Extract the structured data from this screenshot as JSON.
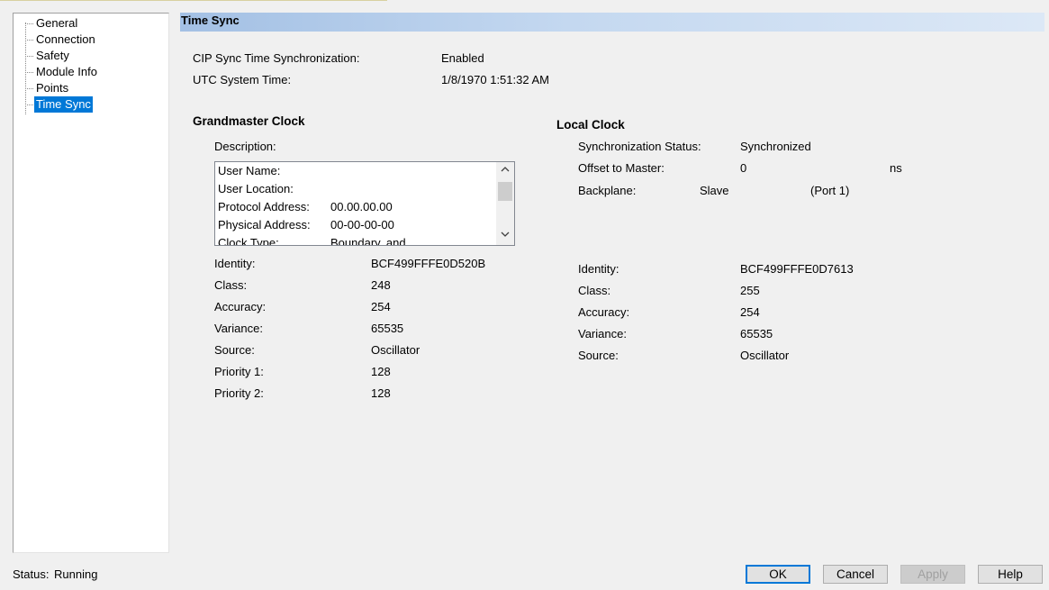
{
  "tree": {
    "items": [
      {
        "label": "General"
      },
      {
        "label": "Connection"
      },
      {
        "label": "Safety"
      },
      {
        "label": "Module Info"
      },
      {
        "label": "Points"
      },
      {
        "label": "Time Sync",
        "selected": true
      }
    ]
  },
  "header": {
    "title": "Time Sync"
  },
  "summary": {
    "cip_sync_label": "CIP Sync Time Synchronization:",
    "cip_sync_value": "Enabled",
    "utc_label": "UTC System Time:",
    "utc_value": "1/8/1970 1:51:32 AM"
  },
  "grandmaster": {
    "title": "Grandmaster Clock",
    "description_label": "Description:",
    "description_rows": [
      {
        "key": "User Name:",
        "value": ""
      },
      {
        "key": "User Location:",
        "value": ""
      },
      {
        "key": "Protocol Address:",
        "value": "00.00.00.00"
      },
      {
        "key": "Physical Address:",
        "value": "00-00-00-00"
      },
      {
        "key": "Clock Type:",
        "value": "Boundary, and"
      }
    ],
    "fields": [
      {
        "label": "Identity:",
        "value": "BCF499FFFE0D520B"
      },
      {
        "label": "Class:",
        "value": "248"
      },
      {
        "label": "Accuracy:",
        "value": "254"
      },
      {
        "label": "Variance:",
        "value": "65535"
      },
      {
        "label": "Source:",
        "value": "Oscillator"
      },
      {
        "label": "Priority 1:",
        "value": "128"
      },
      {
        "label": "Priority 2:",
        "value": "128"
      }
    ]
  },
  "local": {
    "title": "Local Clock",
    "sync_status_label": "Synchronization Status:",
    "sync_status_value": "Synchronized",
    "offset_label": "Offset to Master:",
    "offset_value": "0",
    "offset_unit": "ns",
    "backplane_label": "Backplane:",
    "backplane_value": "Slave",
    "backplane_port": "(Port 1)",
    "fields": [
      {
        "label": "Identity:",
        "value": "BCF499FFFE0D7613"
      },
      {
        "label": "Class:",
        "value": "255"
      },
      {
        "label": "Accuracy:",
        "value": "254"
      },
      {
        "label": "Variance:",
        "value": "65535"
      },
      {
        "label": "Source:",
        "value": "Oscillator"
      }
    ]
  },
  "status": {
    "label": "Status:",
    "value": "Running"
  },
  "buttons": {
    "ok": "OK",
    "cancel": "Cancel",
    "apply": "Apply",
    "help": "Help"
  },
  "icons": {
    "scroll_up": "chevron-up-icon",
    "scroll_down": "chevron-down-icon"
  },
  "colors": {
    "selection": "#0078d7",
    "header_gradient_start": "#a3c0e4"
  }
}
